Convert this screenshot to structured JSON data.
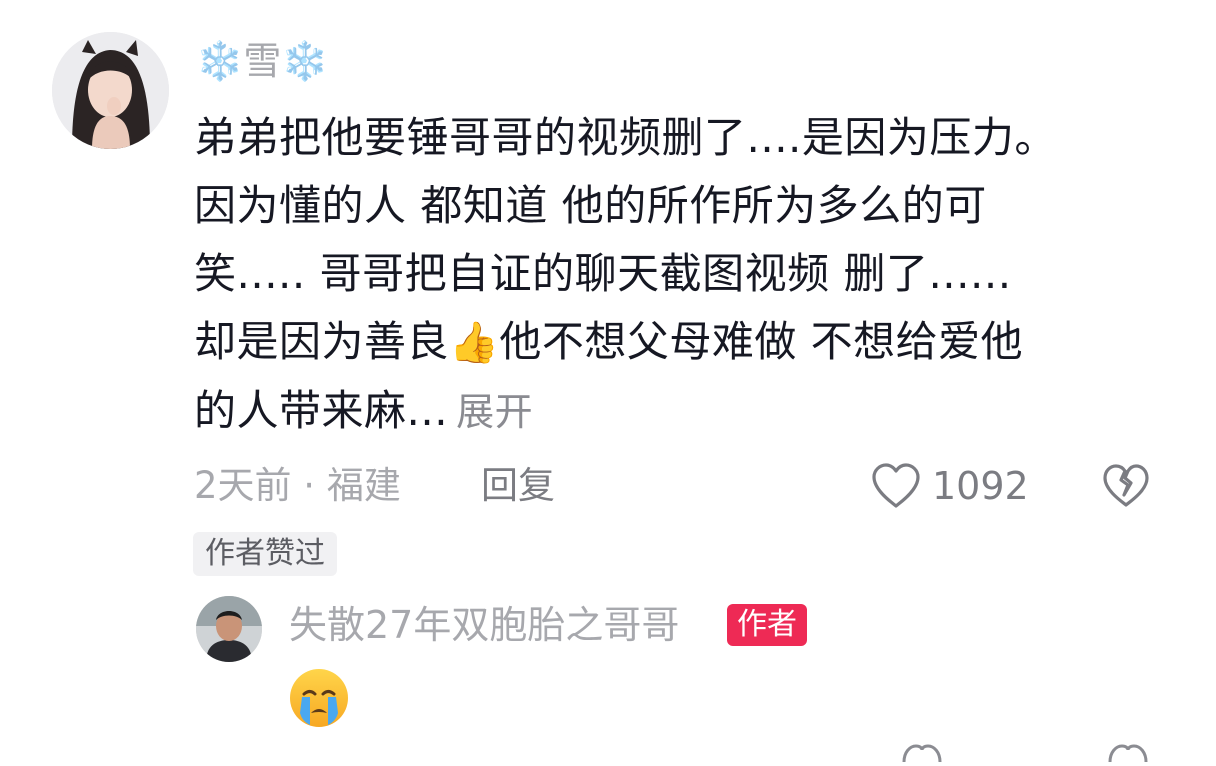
{
  "comment": {
    "username": "❄️雪❄️",
    "username_parts": {
      "left_deco": "❄️",
      "name": "雪",
      "right_deco": "❄️"
    },
    "text_lines": [
      "弟弟把他要锤哥哥的视频删了....是因为压力。",
      "因为懂的人 都知道 他的所作所为多么的可",
      "笑.....  哥哥把自证的聊天截图视频 删了......",
      "却是因为善良",
      "他不想父母难做 不想给爱他",
      "的人带来麻..."
    ],
    "thumb_emoji": "👍",
    "expand_label": "展开",
    "meta": "2天前 · 福建",
    "reply_label": "回复",
    "like_count": "1092",
    "author_liked_tag": "作者赞过"
  },
  "reply": {
    "username": "失散27年双胞胎之哥哥",
    "author_badge": "作者",
    "emoji": "crying-face"
  },
  "icons": {
    "like": "heart-outline-icon",
    "dislike": "broken-heart-icon"
  },
  "colors": {
    "author_badge_bg": "#ee2a55",
    "meta_text": "#a7a8ad",
    "body_text": "#161823"
  }
}
